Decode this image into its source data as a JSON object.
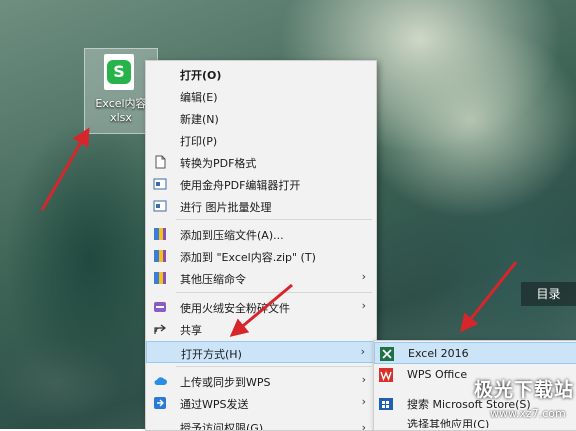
{
  "desktop": {
    "file": {
      "icon_letter": "S",
      "name_line1": "Excel内容",
      "name_line2": "xlsx"
    },
    "side_button": "目录",
    "watermark": "极光下载站",
    "watermark_url": "www.xz7.com"
  },
  "context_menu": {
    "items": [
      {
        "label": "打开(O)",
        "icon": "none",
        "bold": true
      },
      {
        "label": "编辑(E)",
        "icon": "none"
      },
      {
        "label": "新建(N)",
        "icon": "none"
      },
      {
        "label": "打印(P)",
        "icon": "none"
      },
      {
        "label": "转换为PDF格式",
        "icon": "document-icon"
      },
      {
        "label": "使用金舟PDF编辑器打开",
        "icon": "pdf-editor-icon"
      },
      {
        "label": "进行 图片批量处理",
        "icon": "image-batch-icon"
      },
      {
        "label": "添加到压缩文件(A)...",
        "icon": "archive-icon"
      },
      {
        "label": "添加到 \"Excel内容.zip\" (T)",
        "icon": "archive-icon"
      },
      {
        "label": "其他压缩命令",
        "icon": "archive-icon",
        "submenu": true
      },
      {
        "label": "使用火绒安全粉碎文件",
        "icon": "shredder-icon",
        "submenu": true
      },
      {
        "label": "共享",
        "icon": "share-icon"
      },
      {
        "label": "打开方式(H)",
        "icon": "none",
        "submenu": true,
        "highlighted": true
      },
      {
        "label": "上传或同步到WPS",
        "icon": "cloud-icon",
        "submenu": true
      },
      {
        "label": "通过WPS发送",
        "icon": "send-icon",
        "submenu": true
      },
      {
        "label": "授予访问权限(G)",
        "icon": "none",
        "submenu": true
      }
    ],
    "submenu_arrow": "›"
  },
  "open_with_submenu": {
    "items": [
      {
        "label": "Excel 2016",
        "icon": "excel-icon",
        "highlighted": true
      },
      {
        "label": "WPS Office",
        "icon": "wps-icon"
      },
      {
        "label": "搜索 Microsoft Store(S)",
        "icon": "store-icon"
      },
      {
        "label": "选择其他应用(C)",
        "icon": "none"
      }
    ]
  },
  "colors": {
    "menu_bg": "#f2f2f2",
    "highlight": "#cce4f7",
    "arrow_red": "#d7262b",
    "excel_green": "#1e7145",
    "wps_red": "#d7312b"
  }
}
